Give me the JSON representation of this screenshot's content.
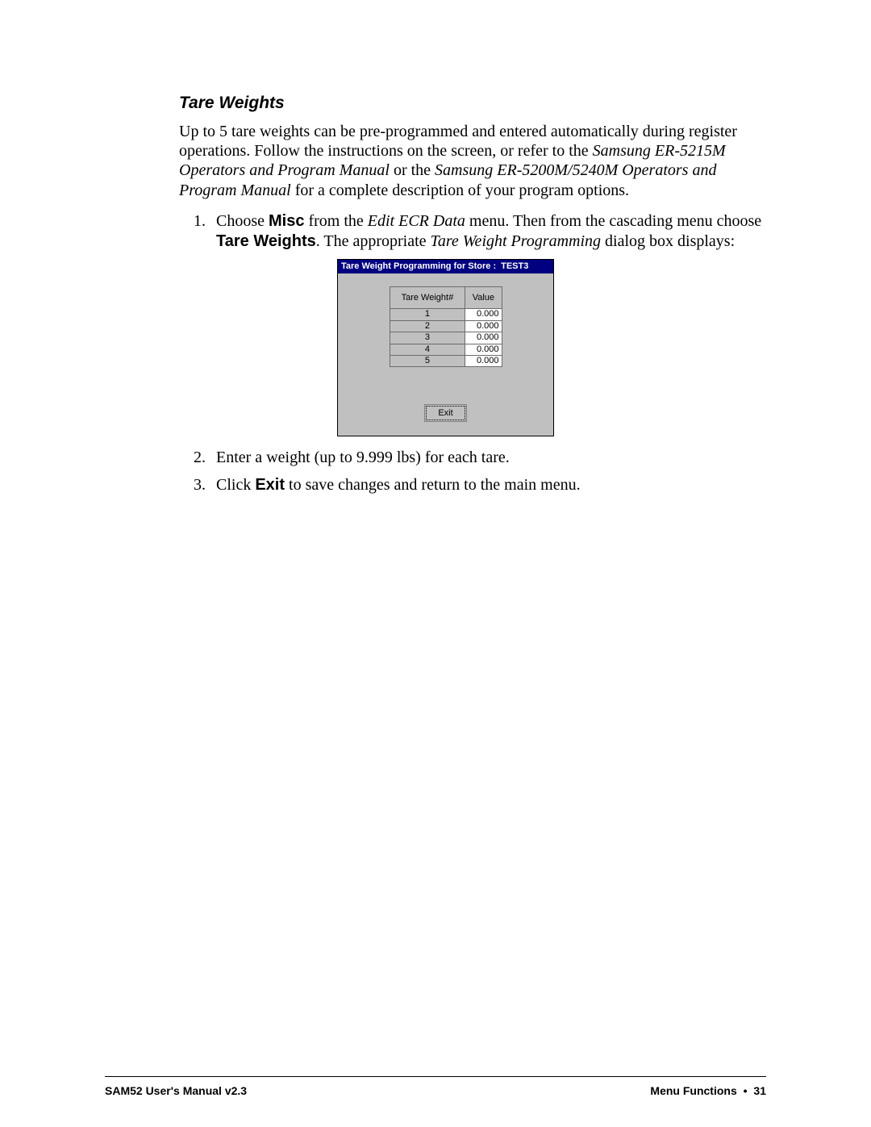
{
  "heading": "Tare Weights",
  "intro": {
    "pre": "Up to 5 tare weights can be pre-programmed and entered automatically during register operations.  Follow the instructions on the screen, or refer to the ",
    "ref1": "Samsung ER-5215M Operators and Program Manual",
    "mid": " or the ",
    "ref2": "Samsung ER-5200M/5240M Operators and Program Manual",
    "post": " for a complete description of your program options."
  },
  "step1": {
    "a": "Choose ",
    "misc": "Misc",
    "b": " from the ",
    "menu1": "Edit ECR Data",
    "c": " menu.  Then from the cascading menu choose ",
    "tw": "Tare Weights",
    "d": ".  The appropriate ",
    "menu2": "Tare Weight Programming",
    "e": " dialog box displays:"
  },
  "step2": "Enter a weight (up to 9.999 lbs) for each tare.",
  "step3": {
    "a": "Click ",
    "exit": "Exit",
    "b": " to save changes and return to the main menu."
  },
  "dialog": {
    "title_label": "Tare Weight Programming for Store :",
    "store_name": "TEST3",
    "col1": "Tare Weight#",
    "col2": "Value",
    "rows": [
      {
        "n": "1",
        "v": "0.000"
      },
      {
        "n": "2",
        "v": "0.000"
      },
      {
        "n": "3",
        "v": "0.000"
      },
      {
        "n": "4",
        "v": "0.000"
      },
      {
        "n": "5",
        "v": "0.000"
      }
    ],
    "exit": "Exit"
  },
  "footer": {
    "left": "SAM52 User's Manual v2.3",
    "right_section": "Menu Functions",
    "bullet": "•",
    "page": "31"
  }
}
